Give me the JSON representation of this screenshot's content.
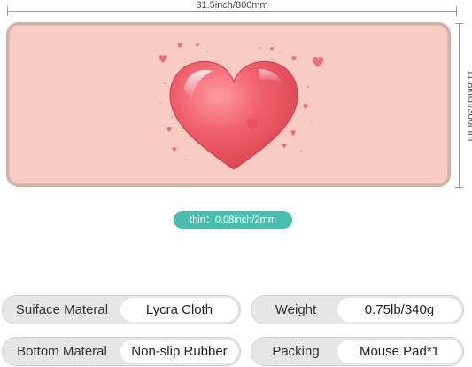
{
  "dimensions": {
    "width_label": "31.5inch/800mm",
    "height_label": "11.8inch/300mm",
    "thickness_label": "thin：0.08inch/2mm"
  },
  "colors": {
    "pad_background": "#f8ccc1",
    "heart_main": "#ef5f6b",
    "thickness_badge": "#48bfae"
  },
  "specs": [
    {
      "label": "Suiface Materal",
      "value": "Lycra Cloth"
    },
    {
      "label": "Weight",
      "value": "0.75lb/340g"
    },
    {
      "label": "Bottom Materal",
      "value": "Non-slip Rubber"
    },
    {
      "label": "Packing",
      "value": "Mouse Pad*1"
    }
  ]
}
